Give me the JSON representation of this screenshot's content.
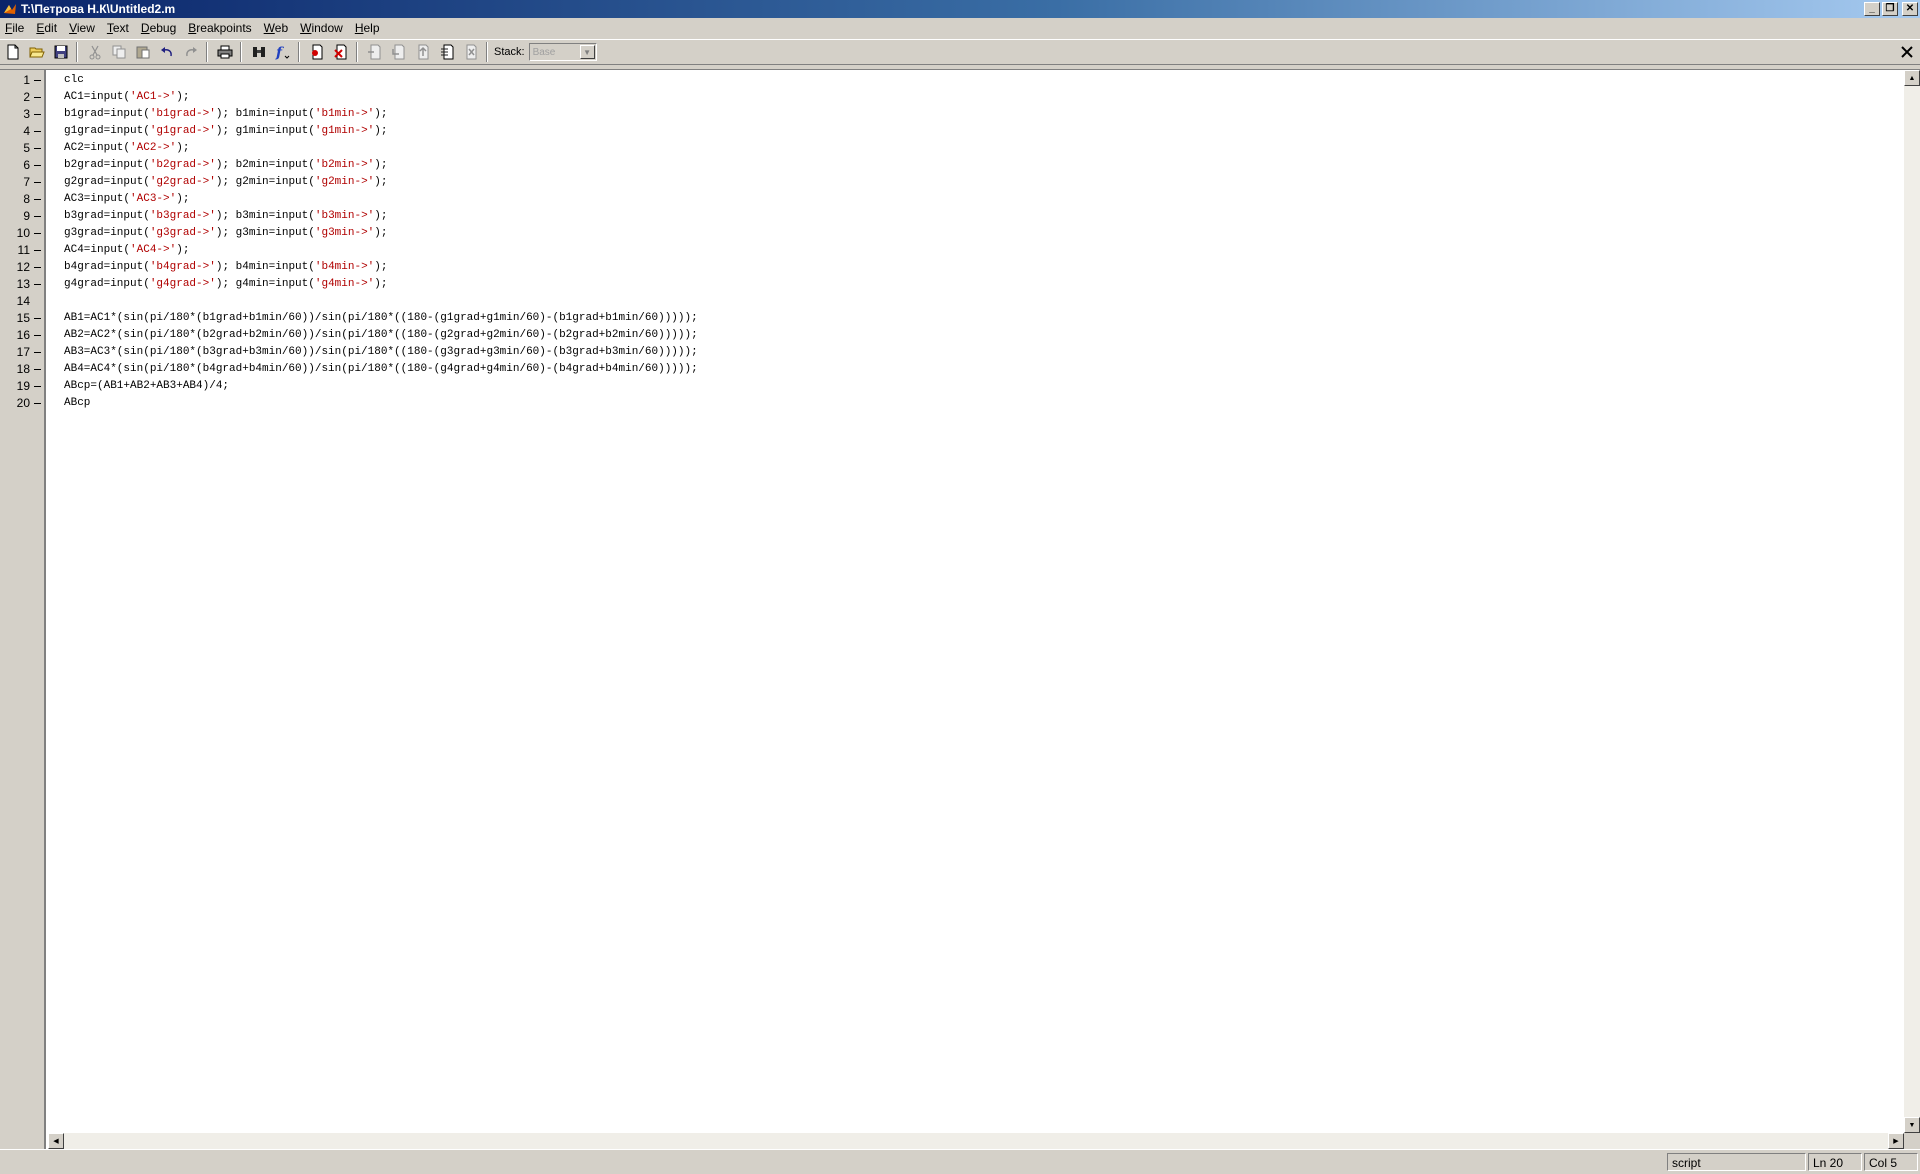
{
  "window": {
    "title": "T:\\Петрова Н.К\\Untitled2.m",
    "minimize": "_",
    "restore": "❐",
    "close": "✕"
  },
  "menu": [
    {
      "label": "File",
      "key": "F",
      "rest": "ile"
    },
    {
      "label": "Edit",
      "key": "E",
      "rest": "dit"
    },
    {
      "label": "View",
      "key": "V",
      "rest": "iew"
    },
    {
      "label": "Text",
      "key": "T",
      "rest": "ext"
    },
    {
      "label": "Debug",
      "key": "D",
      "rest": "ebug"
    },
    {
      "label": "Breakpoints",
      "key": "B",
      "rest": "reakpoints"
    },
    {
      "label": "Web",
      "key": "W",
      "rest": "eb"
    },
    {
      "label": "Window",
      "key": "W",
      "rest": "indow"
    },
    {
      "label": "Help",
      "key": "H",
      "rest": "elp"
    }
  ],
  "toolbar": {
    "stack_label": "Stack:",
    "stack_value": "Base"
  },
  "code_lines": [
    [
      {
        "t": "clc"
      }
    ],
    [
      {
        "t": "AC1=input("
      },
      {
        "t": "'AC1->'",
        "s": 1
      },
      {
        "t": ");"
      }
    ],
    [
      {
        "t": "b1grad=input("
      },
      {
        "t": "'b1grad->'",
        "s": 1
      },
      {
        "t": "); b1min=input("
      },
      {
        "t": "'b1min->'",
        "s": 1
      },
      {
        "t": ");"
      }
    ],
    [
      {
        "t": "g1grad=input("
      },
      {
        "t": "'g1grad->'",
        "s": 1
      },
      {
        "t": "); g1min=input("
      },
      {
        "t": "'g1min->'",
        "s": 1
      },
      {
        "t": ");"
      }
    ],
    [
      {
        "t": "AC2=input("
      },
      {
        "t": "'AC2->'",
        "s": 1
      },
      {
        "t": ");"
      }
    ],
    [
      {
        "t": "b2grad=input("
      },
      {
        "t": "'b2grad->'",
        "s": 1
      },
      {
        "t": "); b2min=input("
      },
      {
        "t": "'b2min->'",
        "s": 1
      },
      {
        "t": ");"
      }
    ],
    [
      {
        "t": "g2grad=input("
      },
      {
        "t": "'g2grad->'",
        "s": 1
      },
      {
        "t": "); g2min=input("
      },
      {
        "t": "'g2min->'",
        "s": 1
      },
      {
        "t": ");"
      }
    ],
    [
      {
        "t": "AC3=input("
      },
      {
        "t": "'AC3->'",
        "s": 1
      },
      {
        "t": ");"
      }
    ],
    [
      {
        "t": "b3grad=input("
      },
      {
        "t": "'b3grad->'",
        "s": 1
      },
      {
        "t": "); b3min=input("
      },
      {
        "t": "'b3min->'",
        "s": 1
      },
      {
        "t": ");"
      }
    ],
    [
      {
        "t": "g3grad=input("
      },
      {
        "t": "'g3grad->'",
        "s": 1
      },
      {
        "t": "); g3min=input("
      },
      {
        "t": "'g3min->'",
        "s": 1
      },
      {
        "t": ");"
      }
    ],
    [
      {
        "t": "AC4=input("
      },
      {
        "t": "'AC4->'",
        "s": 1
      },
      {
        "t": ");"
      }
    ],
    [
      {
        "t": "b4grad=input("
      },
      {
        "t": "'b4grad->'",
        "s": 1
      },
      {
        "t": "); b4min=input("
      },
      {
        "t": "'b4min->'",
        "s": 1
      },
      {
        "t": ");"
      }
    ],
    [
      {
        "t": "g4grad=input("
      },
      {
        "t": "'g4grad->'",
        "s": 1
      },
      {
        "t": "); g4min=input("
      },
      {
        "t": "'g4min->'",
        "s": 1
      },
      {
        "t": ");"
      }
    ],
    [],
    [
      {
        "t": "AB1=AC1*(sin(pi/180*(b1grad+b1min/60))/sin(pi/180*((180-(g1grad+g1min/60)-(b1grad+b1min/60)))));"
      }
    ],
    [
      {
        "t": "AB2=AC2*(sin(pi/180*(b2grad+b2min/60))/sin(pi/180*((180-(g2grad+g2min/60)-(b2grad+b2min/60)))));"
      }
    ],
    [
      {
        "t": "AB3=AC3*(sin(pi/180*(b3grad+b3min/60))/sin(pi/180*((180-(g3grad+g3min/60)-(b3grad+b3min/60)))));"
      }
    ],
    [
      {
        "t": "AB4=AC4*(sin(pi/180*(b4grad+b4min/60))/sin(pi/180*((180-(g4grad+g4min/60)-(b4grad+b4min/60)))));"
      }
    ],
    [
      {
        "t": "ABcp=(AB1+AB2+AB3+AB4)/4;"
      }
    ],
    [
      {
        "t": "ABcp"
      }
    ]
  ],
  "status": {
    "mode": "script",
    "line": "Ln 20",
    "col": "Col 5"
  },
  "colors": {
    "string": "#b00000",
    "titlebar_start": "#0a246a",
    "titlebar_end": "#a6caf0"
  }
}
